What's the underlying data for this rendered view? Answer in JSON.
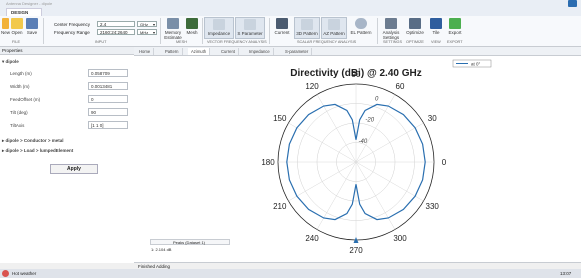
{
  "window": {
    "title": "Antenna Designer - dipole"
  },
  "tab": {
    "design": "DESIGN"
  },
  "ribbon": {
    "file_buttons": [
      "New",
      "Open",
      "Save"
    ],
    "center_frequency_label": "Center Frequency",
    "center_frequency_value": "2.4",
    "center_frequency_unit": "GHz",
    "frequency_range_label": "Frequency Range",
    "frequency_range_value": "2160:24:2640",
    "frequency_range_unit": "MHz",
    "memory_estimate": "Memory Estimate",
    "mesh": "Mesh",
    "impedance": "Impedance",
    "s_parameter": "S Parameter",
    "current": "Current",
    "pattern_3d": "3D Pattern",
    "pattern_az": "AZ Pattern",
    "pattern_el": "EL Pattern",
    "analysis_settings": "Analysis Settings",
    "optimize": "Optimize",
    "tile": "Tile",
    "export": "Export",
    "groups": [
      "FILE",
      "INPUT",
      "MESH",
      "VECTOR FREQUENCY ANALYSIS",
      "SCALAR FREQUENCY ANALYSIS",
      "SETTINGS",
      "OPTIMIZE",
      "VIEW",
      "EXPORT"
    ]
  },
  "props": {
    "header": "Properties",
    "section_dipole": "dipole",
    "fields": [
      {
        "label": "Length (m)",
        "value": "0.058709"
      },
      {
        "label": "Width (m)",
        "value": "0.0013481"
      },
      {
        "label": "FeedOffset (m)",
        "value": "0"
      },
      {
        "label": "Tilt (deg)",
        "value": "90"
      },
      {
        "label": "TiltAxis",
        "value": "[1 1 0]"
      }
    ],
    "section_conductor": "dipole > Conductor > metal",
    "section_load": "dipole > Load > lumpedElement",
    "apply": "Apply"
  },
  "doc_tabs": [
    "Home",
    "Pattern",
    "Azimuth",
    "Current",
    "Impedance",
    "S-parameter"
  ],
  "legend": "at 0°",
  "chart_data": {
    "type": "polar",
    "title": "Directivity (dBi) @ 2.40 GHz",
    "angle_ticks": [
      "90",
      "60",
      "30",
      "0",
      "330",
      "300",
      "270",
      "240",
      "210",
      "180",
      "150",
      "120"
    ],
    "radial_ticks": [
      "0",
      "-20",
      "-40"
    ],
    "radial_range": [
      -60,
      10
    ],
    "note": "Figure-eight pattern: max ~2.1 dBi at 0° and 180°, deep nulls near 90° and 270°",
    "series": [
      {
        "angles_deg": [
          0,
          15,
          30,
          45,
          60,
          70,
          80,
          85,
          90,
          95,
          100,
          110,
          120,
          135,
          150,
          165,
          180,
          195,
          210,
          225,
          240,
          250,
          260,
          265,
          270,
          275,
          280,
          290,
          300,
          315,
          330,
          345
        ],
        "values_dbi": [
          2.1,
          1.9,
          1.3,
          0.2,
          -2.0,
          -5.0,
          -13.0,
          -22.0,
          -40.0,
          -22.0,
          -13.0,
          -5.0,
          -2.0,
          0.2,
          1.3,
          1.9,
          2.1,
          1.9,
          1.3,
          0.2,
          -2.0,
          -5.0,
          -13.0,
          -22.0,
          -40.0,
          -22.0,
          -13.0,
          -5.0,
          -2.0,
          0.2,
          1.3,
          1.9
        ]
      }
    ]
  },
  "peaks": {
    "title": "Peaks (Dataset 1)",
    "value": "1: 2.104 dB"
  },
  "status": "Finished Adding",
  "taskbar": {
    "weather": "Hot weather",
    "time": "13:07"
  }
}
